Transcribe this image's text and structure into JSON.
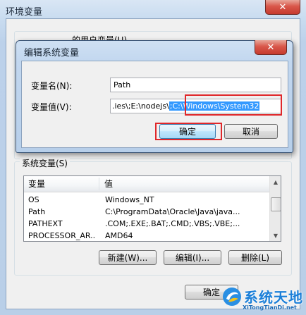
{
  "outer_window": {
    "title": "环境变量",
    "close_glyph": "✕",
    "user_vars_group_title": "的用户变量(U)",
    "system_vars_group_title": "系统变量(S)",
    "system_vars_table": {
      "columns": [
        "变量",
        "值"
      ],
      "rows": [
        {
          "name": "OS",
          "value": "Windows_NT"
        },
        {
          "name": "Path",
          "value": "C:\\ProgramData\\Oracle\\Java\\java..."
        },
        {
          "name": "PATHEXT",
          "value": ".COM;.EXE;.BAT;.CMD;.VBS;.VBE;..."
        },
        {
          "name": "PROCESSOR_AR...",
          "value": "AMD64"
        }
      ]
    },
    "buttons": {
      "new": "新建(W)...",
      "edit": "编辑(I)...",
      "delete": "删除(L)",
      "ok": "确定"
    }
  },
  "edit_dialog": {
    "title": "编辑系统变量",
    "close_glyph": "✕",
    "name_label": "变量名(N):",
    "name_value": "Path",
    "value_label": "变量值(V):",
    "value_text_before": ".ies\\;E:\\nodejs\\",
    "value_text_selected": ";C:\\Windows\\System32",
    "ok_label": "确定",
    "cancel_label": "取消",
    "highlight_color": "#e0272a"
  },
  "watermark": {
    "text": "系统天地",
    "url": "XiTongTianDi.net"
  }
}
